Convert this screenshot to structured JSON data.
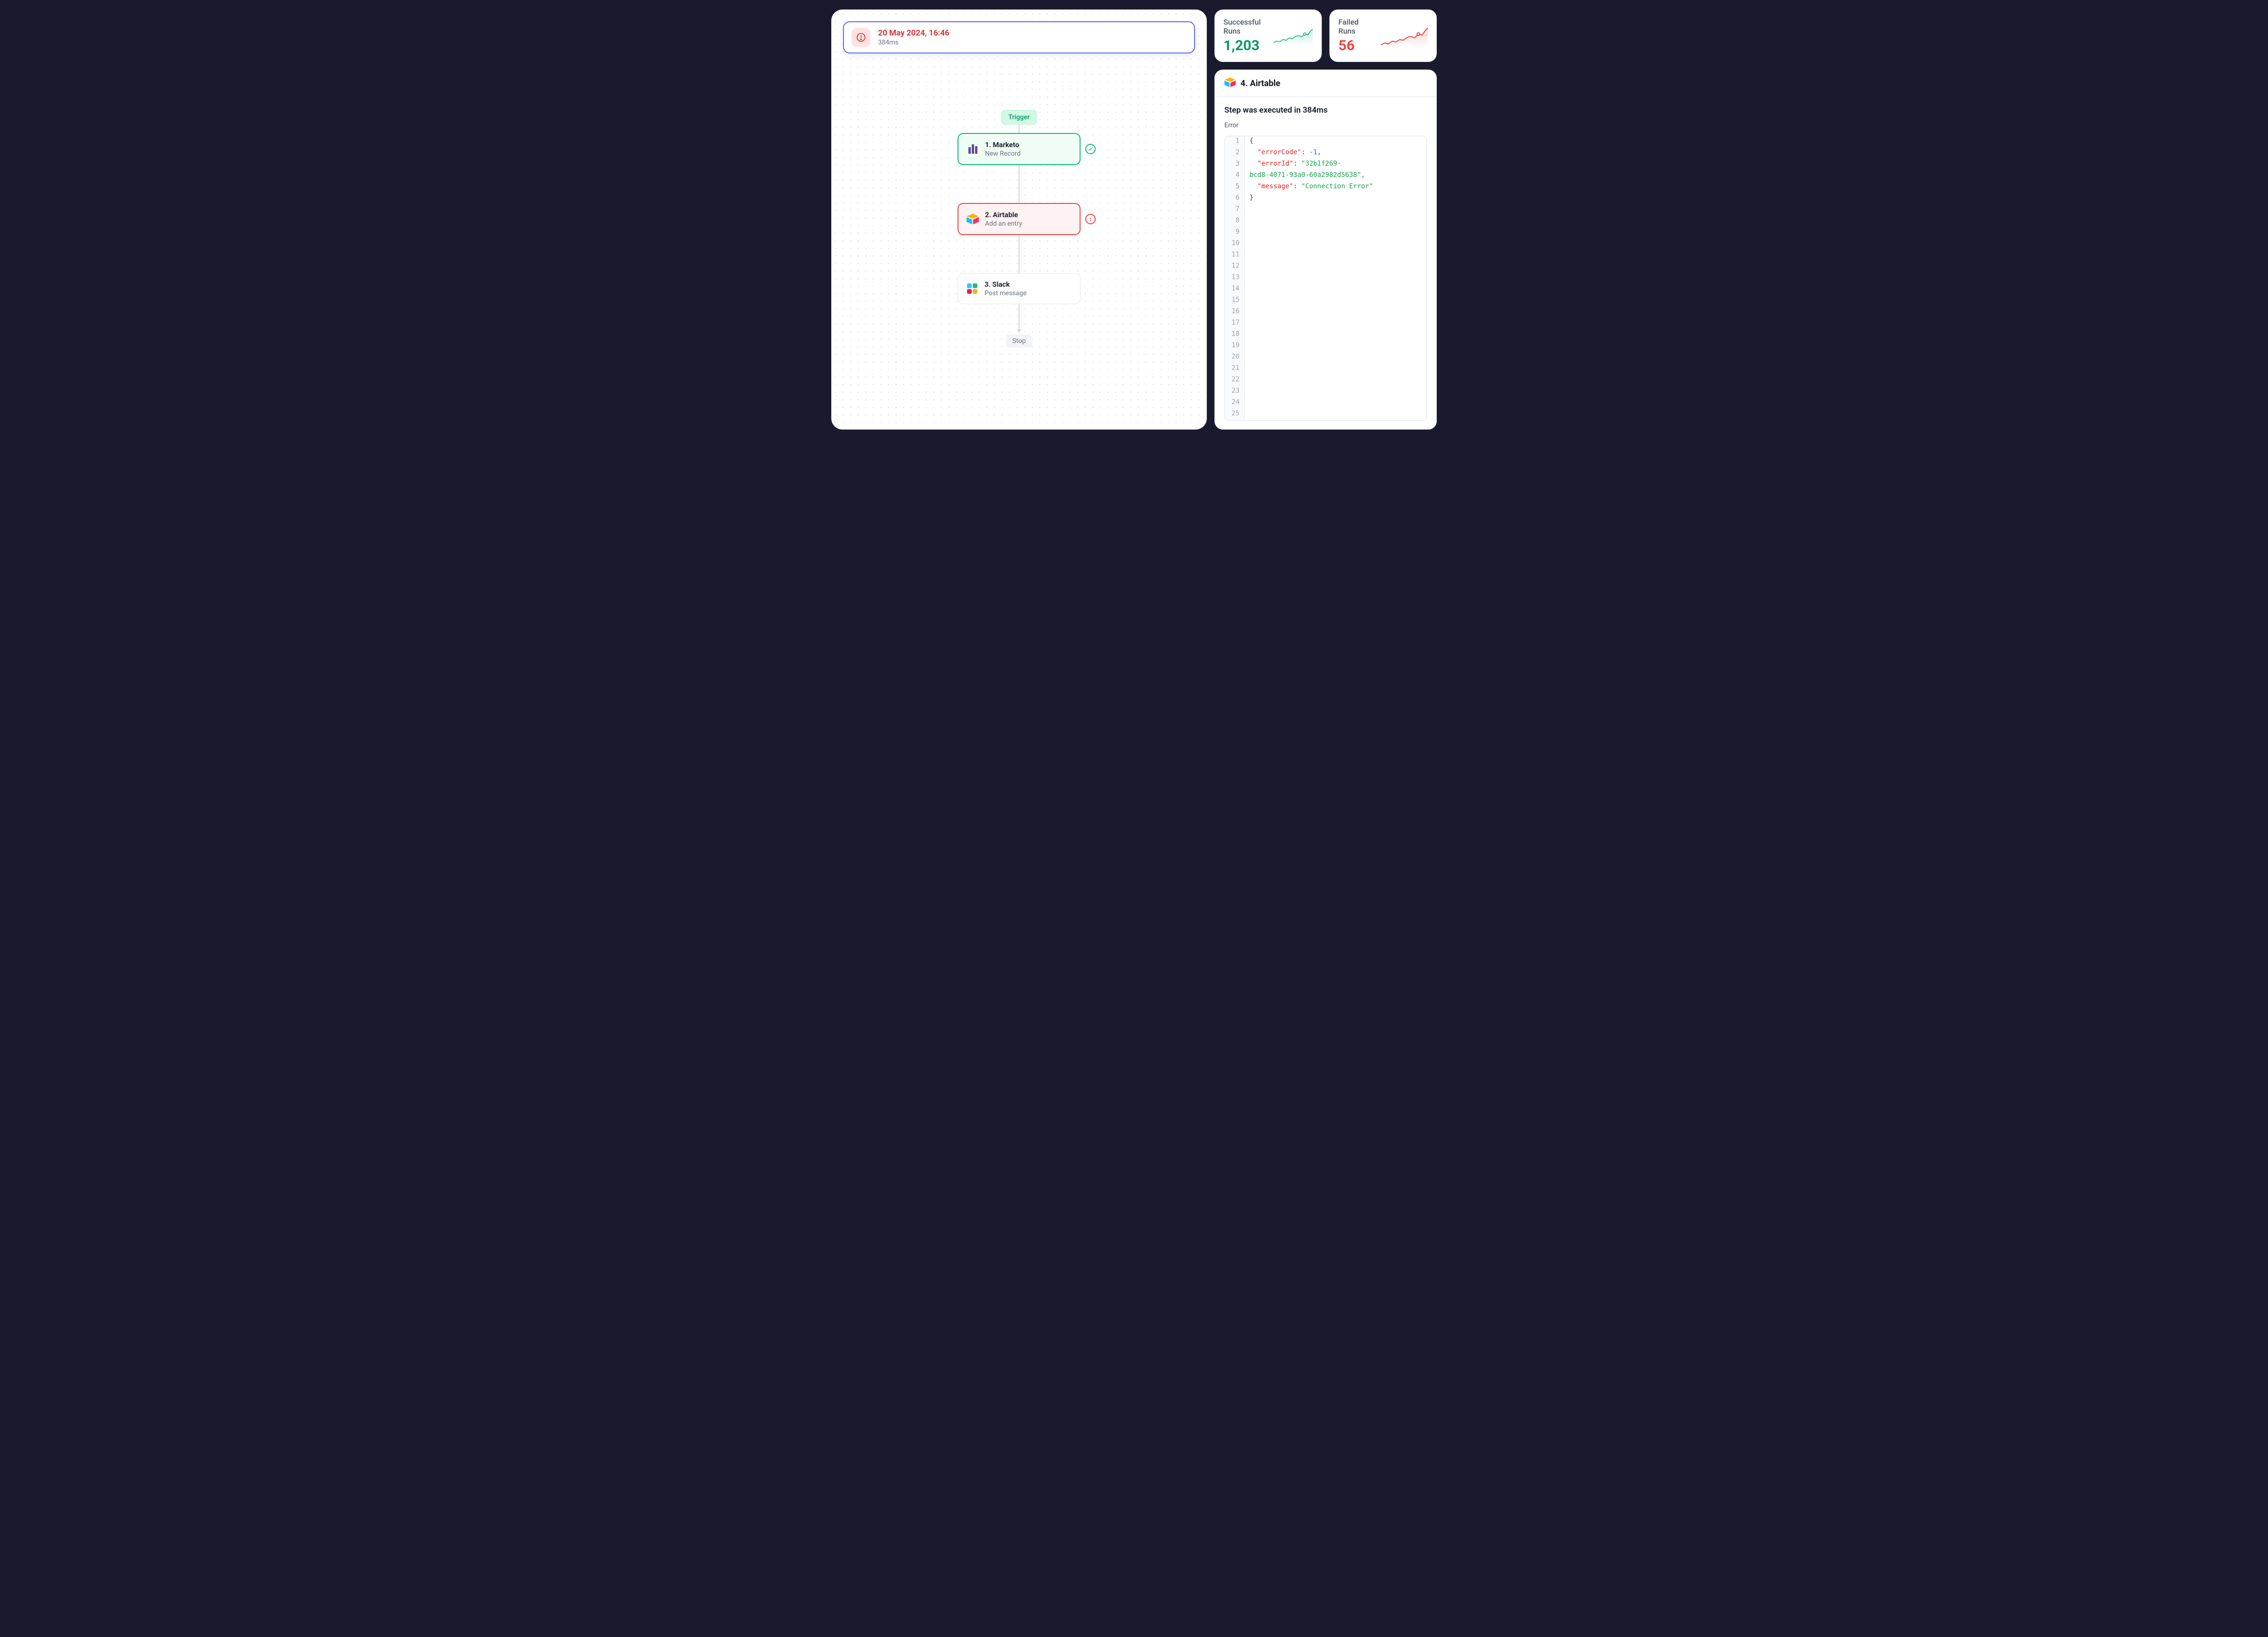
{
  "run": {
    "timestamp": "20 May 2024, 16:46",
    "duration": "384ms"
  },
  "flow": {
    "trigger_label": "Trigger",
    "stop_label": "Stop",
    "nodes": [
      {
        "title": "1. Marketo",
        "subtitle": "New Record",
        "status": "success",
        "icon": "marketo"
      },
      {
        "title": "2. Airtable",
        "subtitle": "Add an entry",
        "status": "error",
        "icon": "airtable"
      },
      {
        "title": "3. Slack",
        "subtitle": "Post message",
        "status": "default",
        "icon": "slack"
      }
    ]
  },
  "stats": {
    "success": {
      "label": "Successful Runs",
      "value": "1,203",
      "color": "#059669"
    },
    "failed": {
      "label": "Failed Runs",
      "value": "56",
      "color": "#ef4444"
    }
  },
  "detail": {
    "title": "4. Airtable",
    "exec_text": "Step was executed in 384ms",
    "error_label": "Error",
    "error_json": {
      "errorCode": -1,
      "errorId": "32b1f269-bcd8-4071-93a0-60a2982d5638",
      "message": "Connection Error"
    },
    "code_lines": [
      "{",
      "  \"errorCode\": -1,",
      "  \"errorId\": \"32b1f269-",
      "bcd8-4071-93a0-60a2982d5638\",",
      "  \"message\": \"Connection Error\"",
      "}"
    ],
    "total_lines": 25
  },
  "chart_data": [
    {
      "type": "line",
      "title": "Successful Runs sparkline",
      "values": [
        20,
        24,
        22,
        27,
        25,
        30,
        28,
        33,
        35,
        32,
        38,
        36,
        42,
        45
      ],
      "color": "#059669"
    },
    {
      "type": "line",
      "title": "Failed Runs sparkline",
      "values": [
        18,
        22,
        20,
        25,
        23,
        27,
        26,
        30,
        32,
        29,
        35,
        33,
        40,
        44
      ],
      "color": "#ef4444"
    }
  ]
}
